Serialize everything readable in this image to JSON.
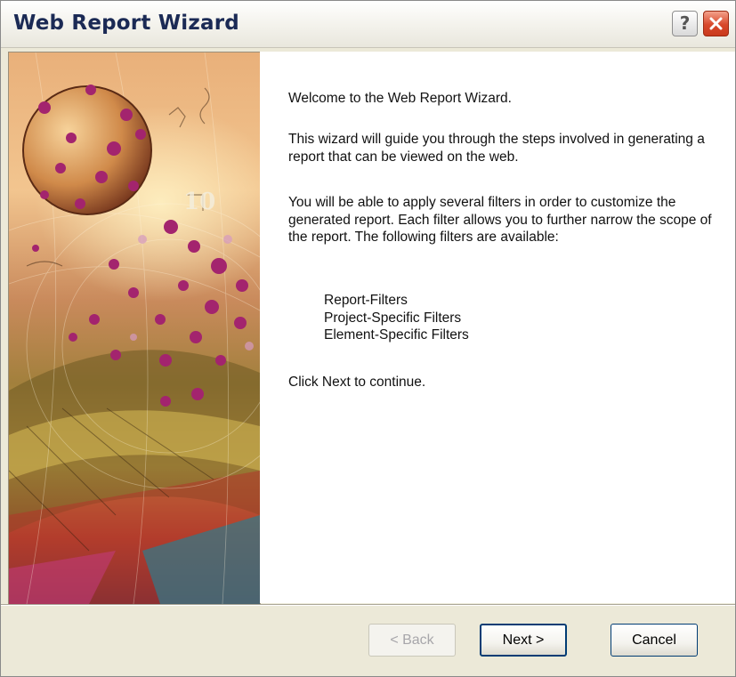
{
  "window": {
    "title": "Web Report Wizard",
    "help_glyph": "?",
    "close_icon": "close-icon",
    "help_icon": "help-icon"
  },
  "content": {
    "welcome": "Welcome to the Web Report Wizard.",
    "guide": "This wizard will guide you through the steps involved in generating a report that can be viewed on the web.",
    "filters_intro": "You will be able to apply several filters in order to customize the generated report.  Each filter allows you to further narrow the scope of the report.  The following filters are available:",
    "filters": [
      "Report-Filters",
      "Project-Specific Filters",
      "Element-Specific Filters"
    ],
    "continue": "Click Next to continue."
  },
  "buttons": {
    "back": "< Back",
    "next": "Next >",
    "cancel": "Cancel",
    "back_enabled": false
  },
  "colors": {
    "title_text": "#1b2a55",
    "close_button": "#d8482a",
    "dialog_face": "#ece9d8",
    "default_button_border": "#003c74"
  }
}
